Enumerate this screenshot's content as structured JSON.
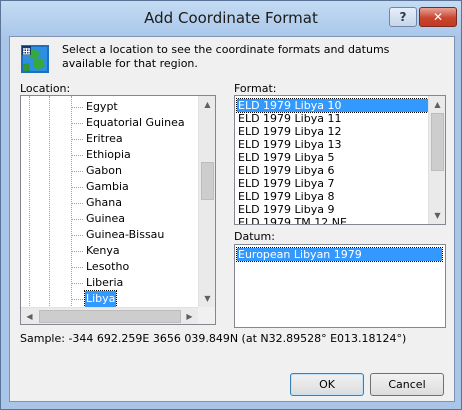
{
  "window": {
    "title": "Add Coordinate Format",
    "help_label": "?",
    "close_label": "✕"
  },
  "intro_text": "Select a location to see the coordinate formats and datums available for that region.",
  "location": {
    "label": "Location:",
    "items": [
      "Egypt",
      "Equatorial Guinea",
      "Eritrea",
      "Ethiopia",
      "Gabon",
      "Gambia",
      "Ghana",
      "Guinea",
      "Guinea-Bissau",
      "Kenya",
      "Lesotho",
      "Liberia",
      "Libya"
    ],
    "selected": "Libya"
  },
  "format": {
    "label": "Format:",
    "items": [
      "ELD 1979 Libya 10",
      "ELD 1979 Libya 11",
      "ELD 1979 Libya 12",
      "ELD 1979 Libya 13",
      "ELD 1979 Libya 5",
      "ELD 1979 Libya 6",
      "ELD 1979 Libya 7",
      "ELD 1979 Libya 8",
      "ELD 1979 Libya 9",
      "ELD 1979 TM 12 NE"
    ],
    "selected": "ELD 1979 Libya 10"
  },
  "datum": {
    "label": "Datum:",
    "items": [
      "European Libyan 1979"
    ],
    "selected": "European Libyan 1979"
  },
  "sample_text": "Sample: -344 692.259E  3656 039.849N (at N32.89528°  E013.18124°)",
  "buttons": {
    "ok": "OK",
    "cancel": "Cancel"
  },
  "colors": {
    "selection": "#3399ff",
    "frame": "#a9c6e8",
    "dialog_bg": "#f0f0f0"
  },
  "icons": {
    "app": "globe-grid-icon",
    "scroll_up": "triangle-up-icon",
    "scroll_down": "triangle-down-icon",
    "scroll_left": "triangle-left-icon",
    "scroll_right": "triangle-right-icon"
  }
}
